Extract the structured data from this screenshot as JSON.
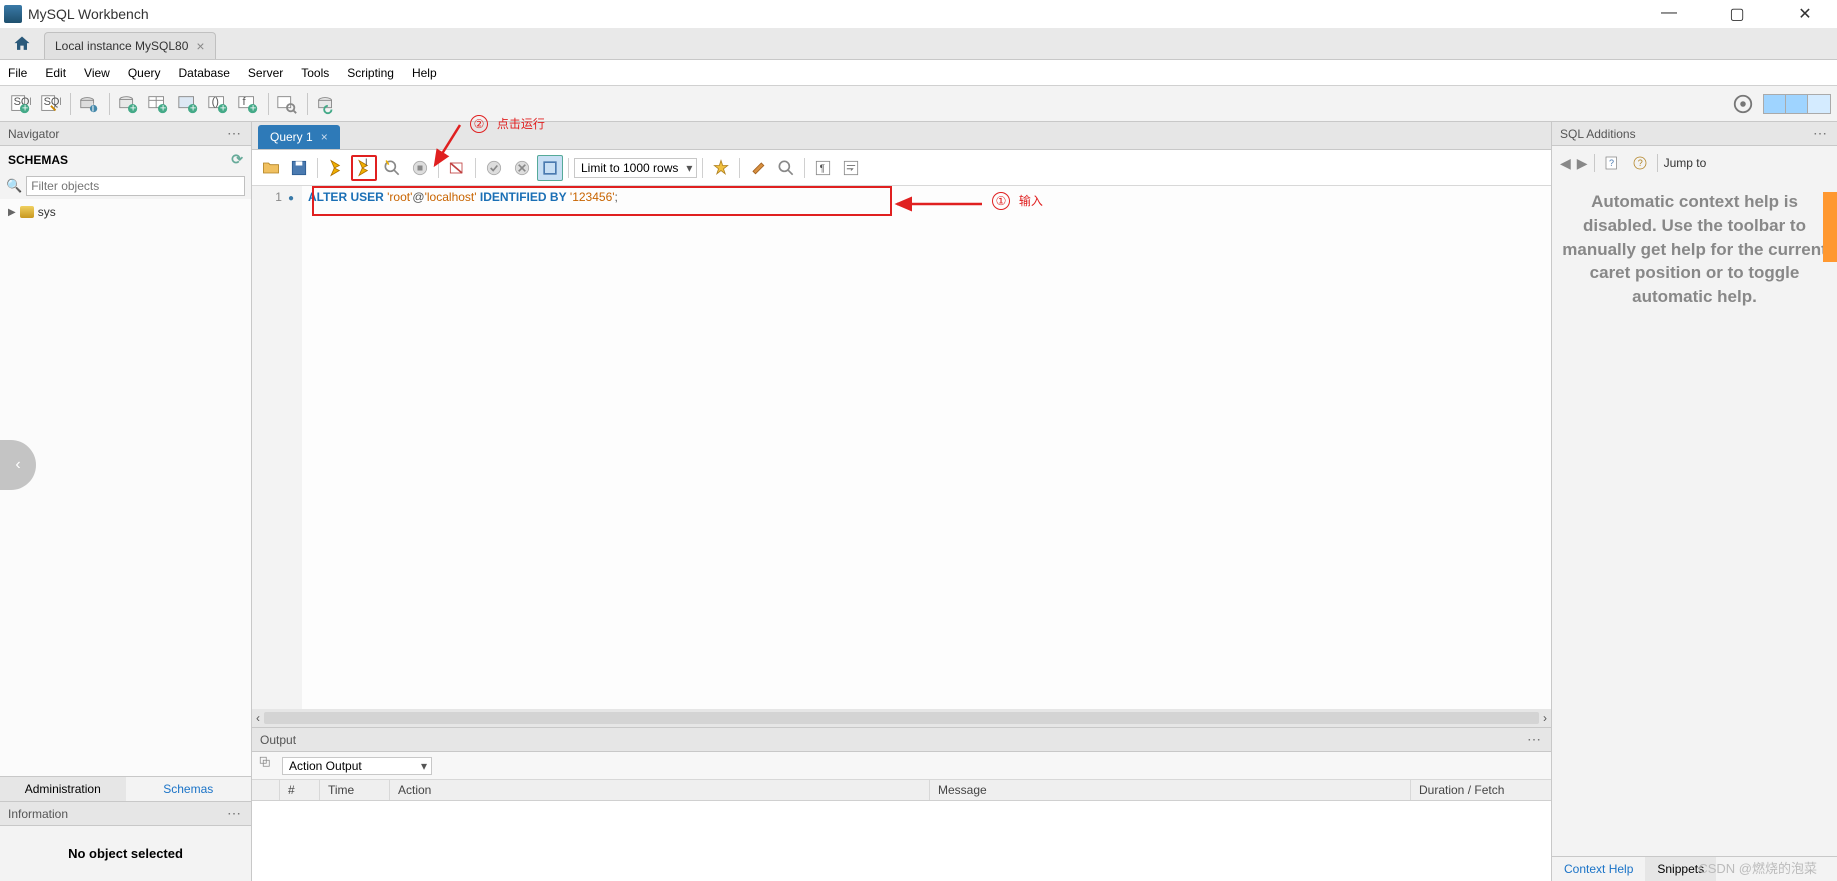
{
  "app": {
    "title": "MySQL Workbench"
  },
  "window_controls": {
    "min": "—",
    "max": "▢",
    "close": "✕"
  },
  "connection_tab": {
    "label": "Local instance MySQL80",
    "close": "×"
  },
  "menu": [
    "File",
    "Edit",
    "View",
    "Query",
    "Database",
    "Server",
    "Tools",
    "Scripting",
    "Help"
  ],
  "navigator": {
    "title": "Navigator",
    "schemas_header": "SCHEMAS",
    "filter_placeholder": "Filter objects",
    "tree": [
      {
        "label": "sys"
      }
    ],
    "tabs": {
      "admin": "Administration",
      "schemas": "Schemas"
    },
    "info_header": "Information",
    "info_body": "No object selected"
  },
  "query": {
    "tab_label": "Query 1",
    "tab_close": "×",
    "limit_label": "Limit to 1000 rows",
    "line_number": "1",
    "sql": {
      "kw1": "ALTER",
      "kw2": "USER",
      "str1": "'root'",
      "at": "@",
      "str2": "'localhost'",
      "kw3": "IDENTIFIED",
      "kw4": "BY",
      "str3": "'123456'",
      "semi": ";"
    }
  },
  "annotations": {
    "run_num": "②",
    "run_text": "点击运行",
    "input_num": "①",
    "input_text": "输入"
  },
  "output": {
    "header": "Output",
    "selector": "Action Output",
    "cols": {
      "blank": "",
      "num": "#",
      "time": "Time",
      "action": "Action",
      "message": "Message",
      "duration": "Duration / Fetch"
    }
  },
  "sql_additions": {
    "title": "SQL Additions",
    "jump": "Jump to",
    "help_text": "Automatic context help is disabled. Use the toolbar to manually get help for the current caret position or to toggle automatic help.",
    "tabs": {
      "ctx": "Context Help",
      "snip": "Snippets"
    }
  },
  "watermark": "CSDN @燃烧的泡菜"
}
